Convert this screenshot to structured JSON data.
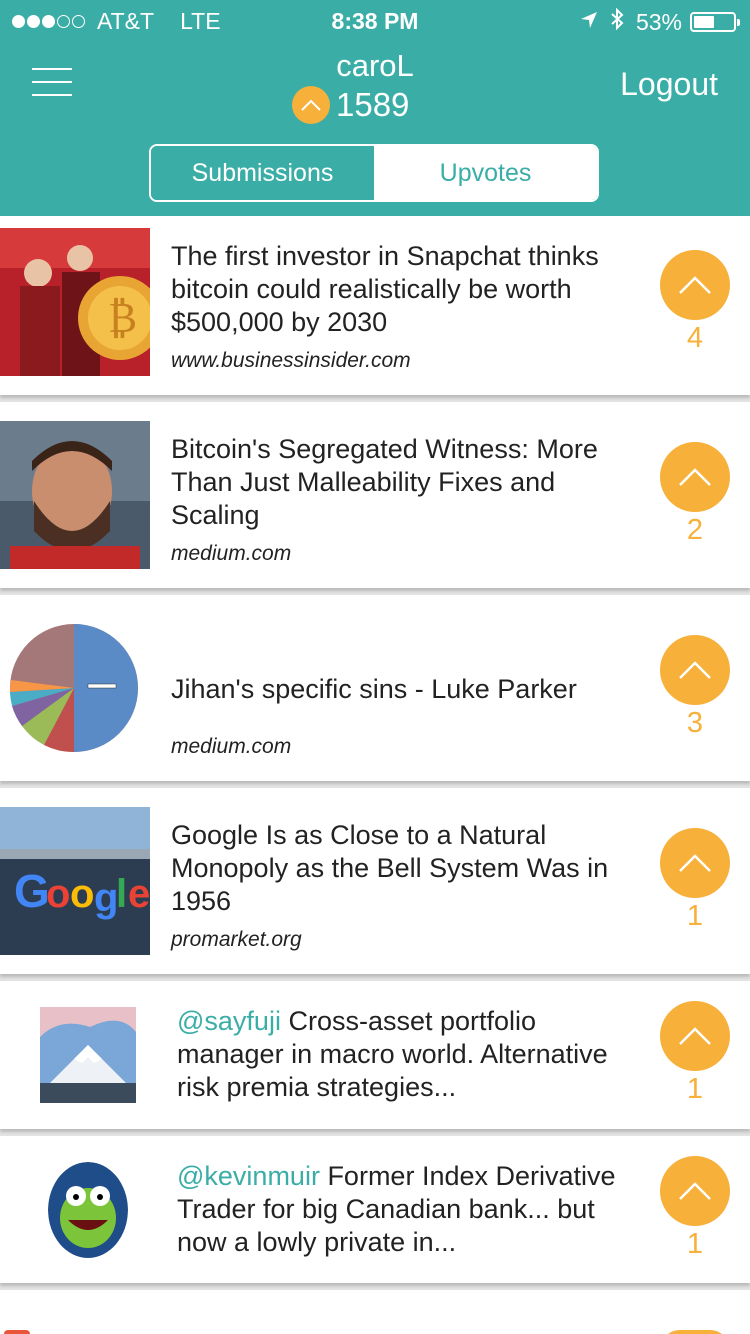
{
  "status_bar": {
    "signal": "●●●○○",
    "carrier": "AT&T",
    "network": "LTE",
    "time": "8:38 PM",
    "battery": "53%"
  },
  "header": {
    "username": "caroL",
    "karma": "1589",
    "logout_label": "Logout",
    "tabs": [
      {
        "label": "Submissions",
        "active": true
      },
      {
        "label": "Upvotes",
        "active": false
      }
    ]
  },
  "colors": {
    "primary": "#3aaea6",
    "accent": "#f7b03a"
  },
  "items": [
    {
      "title": "The first investor in Snapchat thinks bitcoin could realistically be worth $500,000 by 2030",
      "source": "www.businessinsider.com",
      "votes": "4"
    },
    {
      "title": "Bitcoin's Segregated Witness: More Than Just Malleability Fixes and Scaling",
      "source": "medium.com",
      "votes": "2"
    },
    {
      "title": "Jihan's specific sins - Luke Parker",
      "source": "medium.com",
      "votes": "3"
    },
    {
      "title": "Google Is as Close to a Natural Monopoly as the Bell System Was in 1956",
      "source": "promarket.org",
      "votes": "1"
    },
    {
      "handle": "@sayfuji",
      "text": " Cross-asset portfolio manager in macro world. Alternative risk premia strategies...",
      "votes": "1"
    },
    {
      "handle": "@kevinmuir",
      "text": " Former Index Derivative Trader for big Canadian bank... but now a lowly private in...",
      "votes": "1"
    }
  ]
}
